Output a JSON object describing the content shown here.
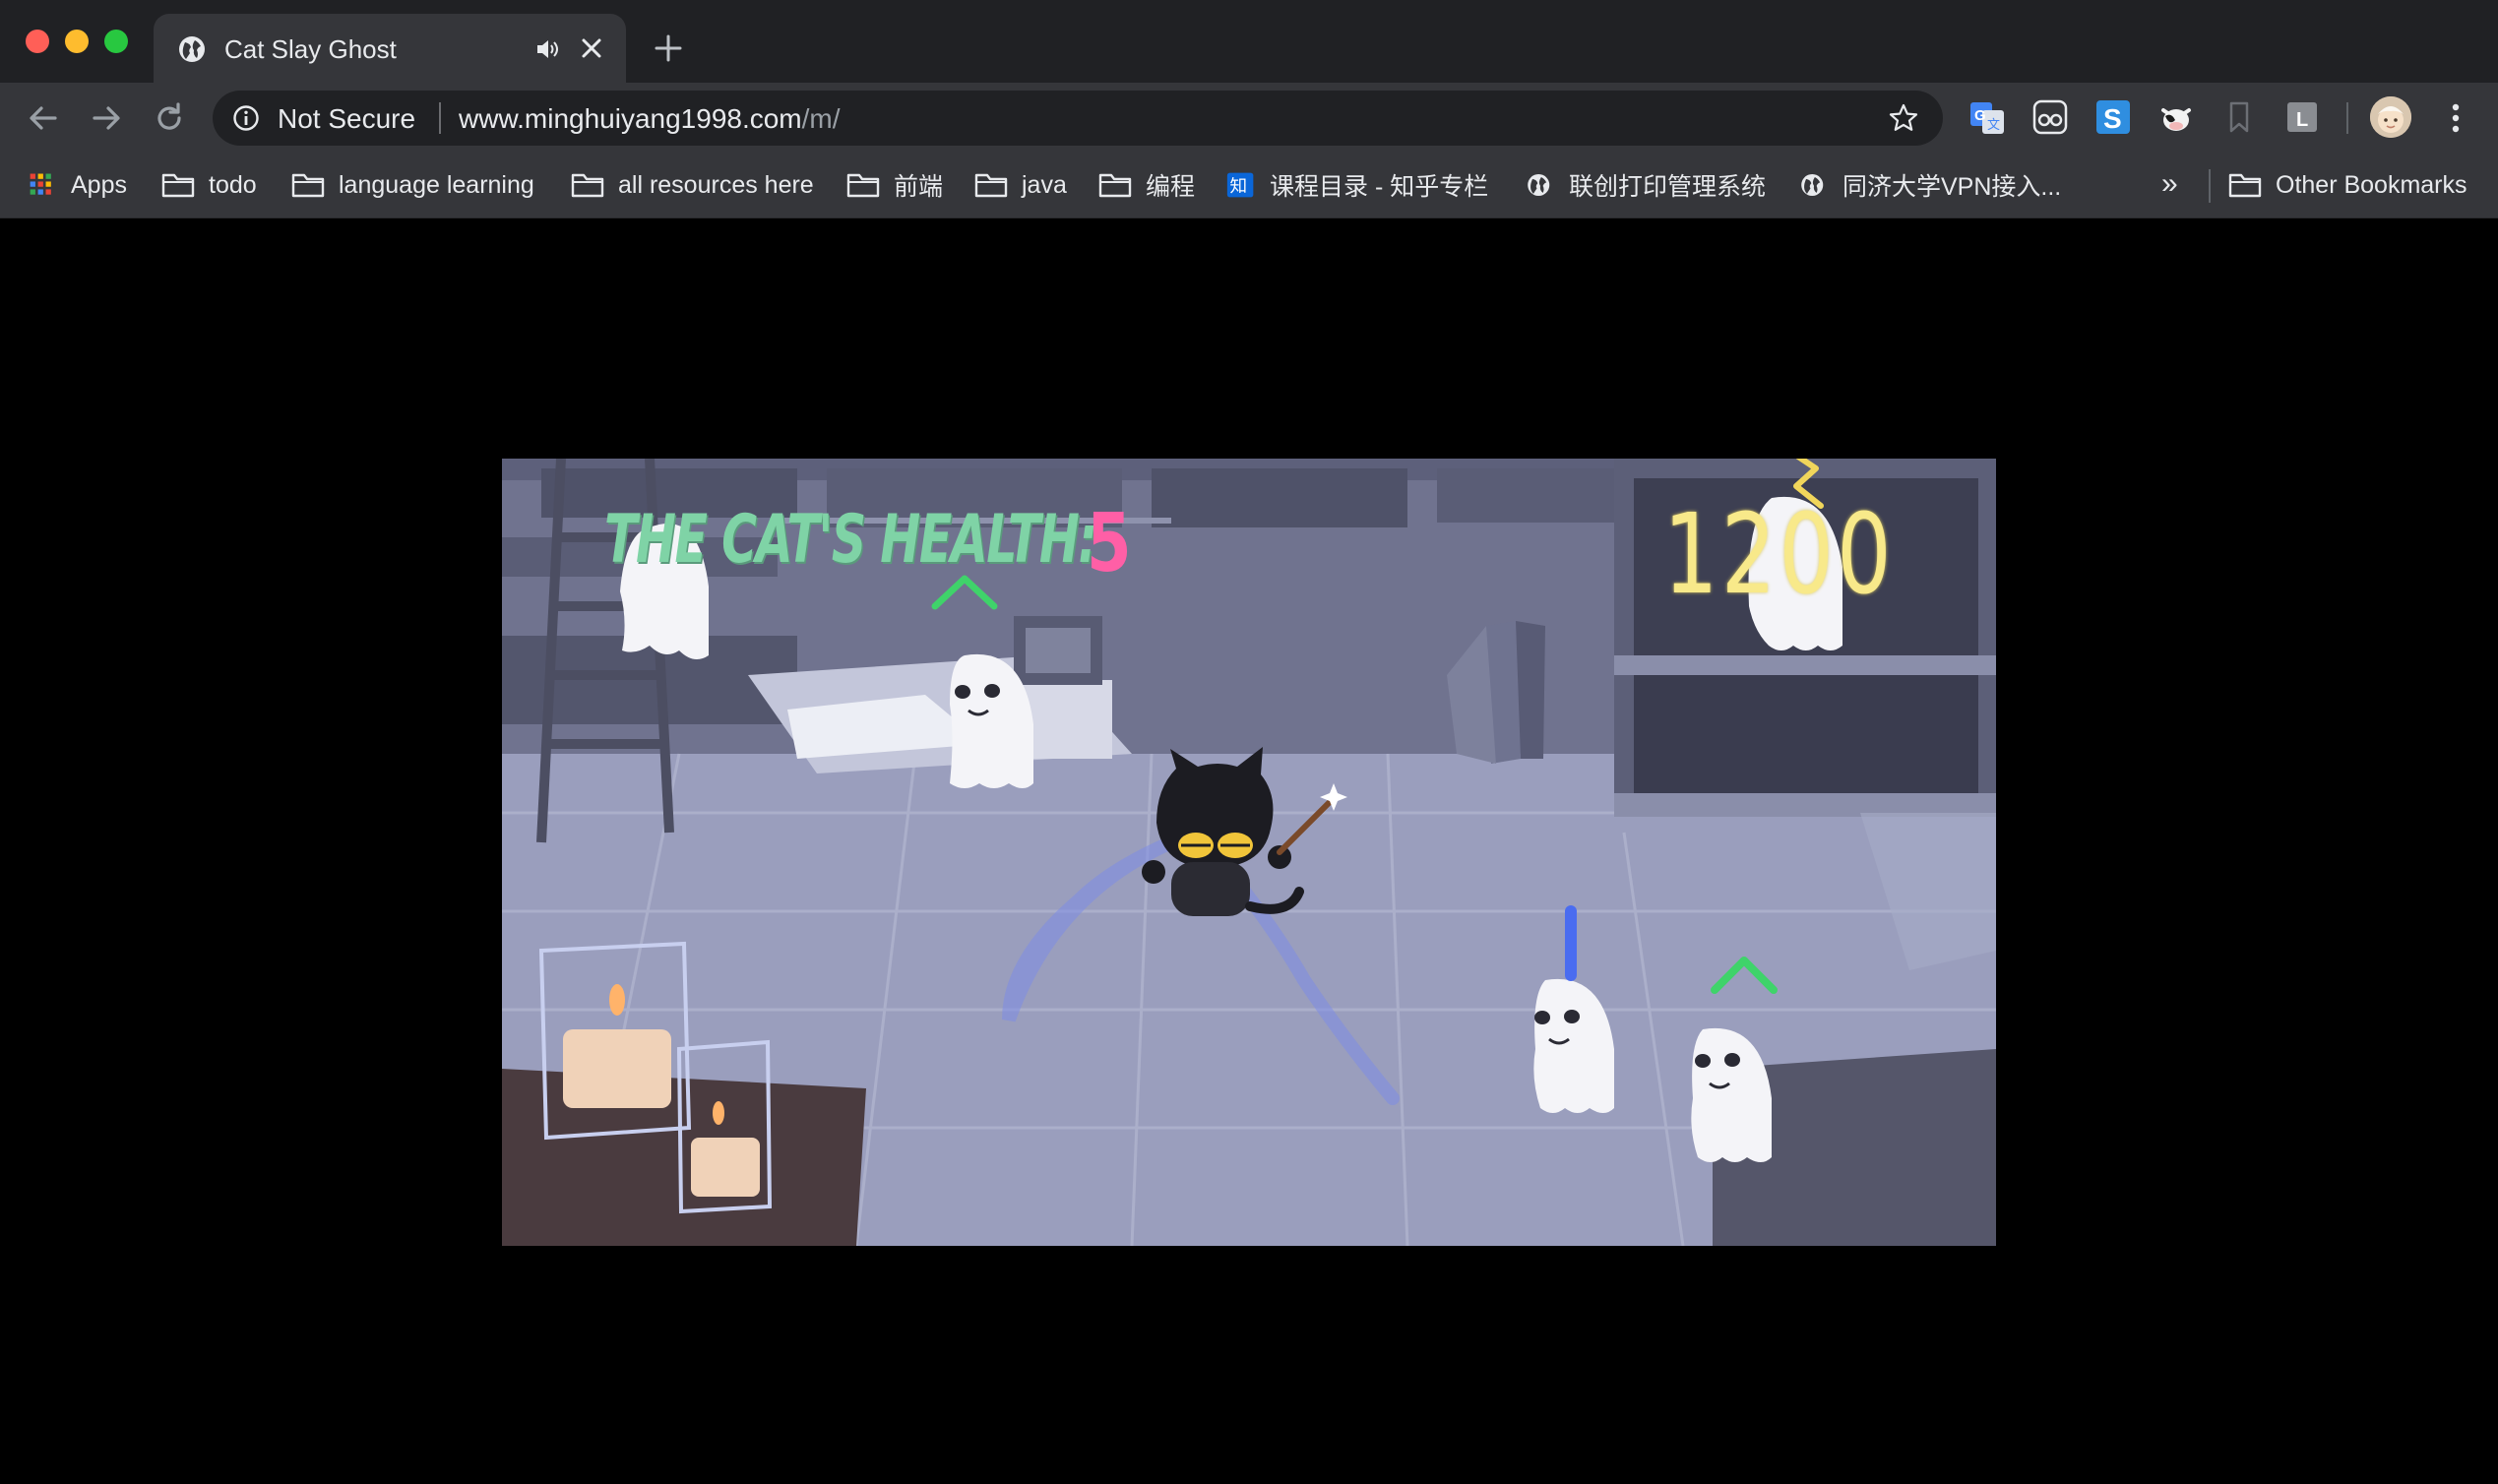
{
  "browser": {
    "tab": {
      "title": "Cat Slay Ghost",
      "favicon": "globe-icon",
      "audio": "speaker-icon"
    },
    "toolbar": {
      "security_label": "Not Secure",
      "url_host": "www.minghuiyang1998.com",
      "url_path": "/m/"
    },
    "extensions": [
      "google-translate-icon",
      "glasses-icon",
      "s-extension-icon",
      "cow-icon",
      "bookmark-icon",
      "l-extension-icon"
    ],
    "bookmarks": [
      {
        "label": "Apps",
        "icon": "apps-grid-icon"
      },
      {
        "label": "todo",
        "icon": "folder-icon"
      },
      {
        "label": "language learning",
        "icon": "folder-icon"
      },
      {
        "label": "all resources here",
        "icon": "folder-icon"
      },
      {
        "label": "前端",
        "icon": "folder-icon"
      },
      {
        "label": "java",
        "icon": "folder-icon"
      },
      {
        "label": "编程",
        "icon": "folder-icon"
      },
      {
        "label": "课程目录 - 知乎专栏",
        "icon": "zhihu-icon"
      },
      {
        "label": "联创打印管理系统",
        "icon": "globe-icon"
      },
      {
        "label": "同济大学VPN接入...",
        "icon": "globe-icon"
      }
    ],
    "bookmarks_overflow": "»",
    "other_bookmarks": "Other Bookmarks"
  },
  "game": {
    "health_label": "THE CAT'S HEALTH:",
    "health_value": "5",
    "score": "1200",
    "colors": {
      "health_label": "#7fd3a6",
      "health_value": "#ff5fa6",
      "score": "#f8e98a",
      "symbol_up": "#3fd36a",
      "symbol_vertical": "#4a6cf0",
      "cat": "#1c1c22"
    },
    "ghosts": [
      {
        "name": "ghost-top-left",
        "symbol": "none"
      },
      {
        "name": "ghost-book",
        "symbol": "caret-up"
      },
      {
        "name": "ghost-top-right",
        "symbol": "lightning"
      },
      {
        "name": "ghost-bottom-middle",
        "symbol": "vertical-line"
      },
      {
        "name": "ghost-bottom-right",
        "symbol": "caret-up"
      }
    ]
  }
}
